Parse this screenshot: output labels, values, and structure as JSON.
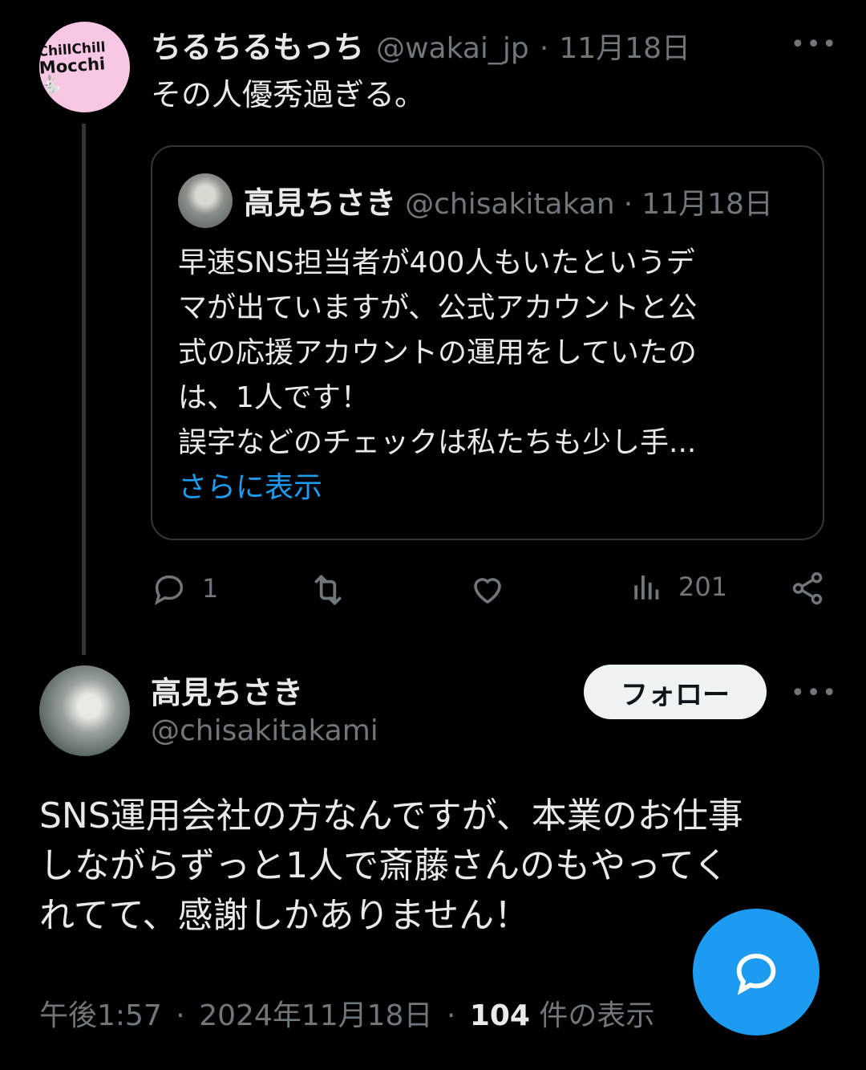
{
  "reply_tweet": {
    "avatar_text_1": "ChillChill",
    "avatar_text_2": "Mocchi",
    "display_name": "ちるちるもっち",
    "handle": "@wakai_jp",
    "separator": "·",
    "date": "11月18日",
    "more_label": "•••",
    "text": "その人優秀過ぎる。",
    "quoted": {
      "display_name": "高見ちさき",
      "handle": "@chisakitakan",
      "separator": "·",
      "date": "11月18日",
      "lines": [
        "早速SNS担当者が400人もいたというデ",
        "マが出ていますが、公式アカウントと公",
        "式の応援アカウントの運用をしていたの",
        "は、1人です！",
        "誤字などのチェックは私たちも少し手..."
      ],
      "show_more": "さらに表示"
    },
    "actions": {
      "reply_count": "1",
      "retweet_count": "",
      "like_count": "",
      "view_count": "201"
    }
  },
  "main_tweet": {
    "display_name": "高見ちさき",
    "handle": "@chisakitakami",
    "follow_label": "フォロー",
    "more_label": "•••",
    "lines": [
      "SNS運用会社の方なんですが、本業のお仕事",
      "しながらずっと1人で斎藤さんのもやってく",
      "れてて、感謝しかありません！"
    ],
    "time": "午後1:57",
    "sep1": "·",
    "date": "2024年11月18日",
    "sep2": "·",
    "view_count": "104",
    "view_label": "件の表示"
  },
  "colors": {
    "background": "#000000",
    "text": "#e7e9ea",
    "muted": "#71767b",
    "accent": "#1d9bf0",
    "border": "#333639"
  }
}
